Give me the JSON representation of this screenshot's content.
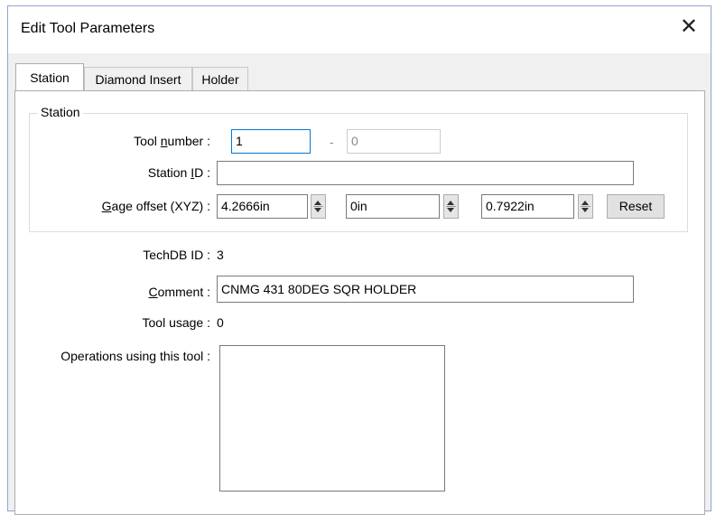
{
  "window": {
    "title": "Edit Tool Parameters",
    "close_glyph": "✕"
  },
  "tabs": [
    {
      "label": "Station"
    },
    {
      "label": "Diamond Insert"
    },
    {
      "label": "Holder"
    }
  ],
  "station_group": {
    "legend": "Station",
    "tool_number": {
      "label_pre": "Tool ",
      "label_ul": "n",
      "label_post": "umber :",
      "value": "1",
      "separator": "-",
      "secondary_value": "0"
    },
    "station_id": {
      "label_pre": "Station ",
      "label_ul": "I",
      "label_post": "D :",
      "value": ""
    },
    "gage_offset": {
      "label_ul": "G",
      "label_post": "age offset (XYZ) :",
      "x": "4.2666in",
      "y": "0in",
      "z": "0.7922in",
      "reset_label": "Reset"
    }
  },
  "techdb": {
    "label": "TechDB ID :",
    "value": "3"
  },
  "comment": {
    "label_ul": "C",
    "label_post": "omment :",
    "value": "CNMG 431 80DEG SQR HOLDER"
  },
  "tool_usage": {
    "label": "Tool usage :",
    "value": "0"
  },
  "operations": {
    "label": "Operations using this tool :",
    "items": []
  },
  "icons": {
    "close": "close-icon",
    "spin": "spinner-arrows-icon"
  }
}
